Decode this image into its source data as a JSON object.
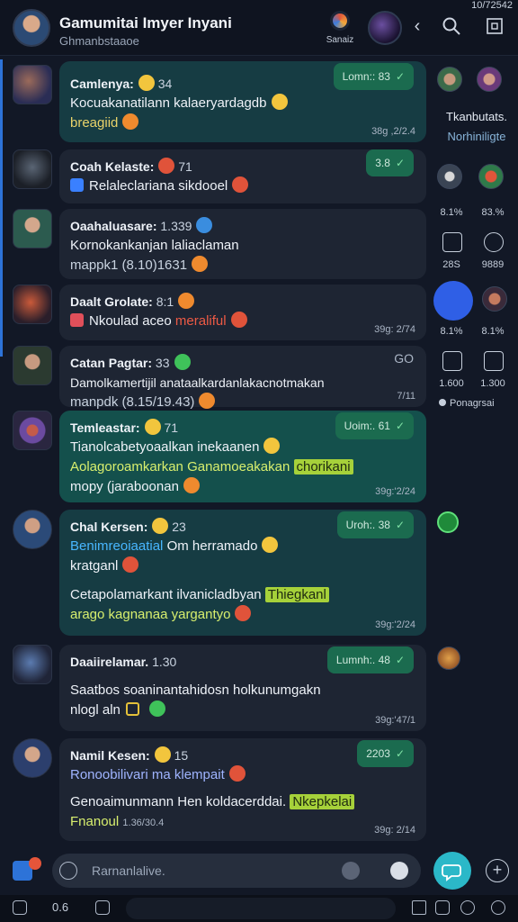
{
  "status_bar": {
    "time": "10/72542"
  },
  "header": {
    "title": "Gamumitai Imyer Inyani",
    "subtitle": "Ghmanbstaaoe",
    "app_label": "Sanaiz",
    "back_icon": "chevron-left-icon",
    "search_icon": "search-icon",
    "menu_icon": "menu-icon"
  },
  "messages": [
    {
      "name": "Camlenya:",
      "count": "34",
      "lines": [
        "Kocuakanatilann kalaeryardagdb",
        "breagiid"
      ],
      "badge": "Lomn:: 83",
      "time": "38g ,2/2.4"
    },
    {
      "name": "Coah Kelaste:",
      "count": "71",
      "lines": [
        "Relaleclariana sikdooel"
      ],
      "badge": "3.8",
      "time": ""
    },
    {
      "name": "Oaahaluasare:",
      "count": "1.339",
      "lines": [
        "Kornokankanjan laliaclaman",
        "mappk1 (8.10)1631"
      ],
      "badge": "",
      "time": ""
    },
    {
      "name": "Daalt Grolate:",
      "count": "8:1",
      "lines": [
        "Nkoulad aceo",
        "meraliful"
      ],
      "badge": "",
      "time": "39g: 2/74"
    },
    {
      "name": "Catan Pagtar:",
      "count": "33",
      "lines": [
        "Damolkamertijil anataalkardanlakacnotmakan",
        "manpdk (8.15/19.43)"
      ],
      "badge": "GO",
      "time": "7/11"
    },
    {
      "name": "Temleastar:",
      "count": "71",
      "lines": [
        "Tianolcabetyoaalkan inekaanen",
        "Aolagoroamkarkan Ganamoeakakan",
        "chorikani",
        "mopy (jaraboonan"
      ],
      "badge": "Uoim:. 61",
      "time": "39g:'2/24"
    },
    {
      "name": "Chal Kersen:",
      "count": "23",
      "lines": [
        "Benimreoiaatial",
        "Om herramado",
        "kratganl",
        "Cetapolamarkant ilvanicladbyan",
        "Thiegkanl",
        "arago kagnanaa yargantyo"
      ],
      "badge": "Uroh:. 38",
      "time": "39g:'2/24"
    },
    {
      "name": "Daaiirelamar.",
      "count": "1.30",
      "lines": [
        "Saatbos soaninantahidosn holkunumgakn",
        "nlogl aln"
      ],
      "badge": "Lumnh:. 48",
      "time": "39g:'47/1"
    },
    {
      "name": "Namil Kesen:",
      "count": "15",
      "lines": [
        "Ronoobilivari ma klempait",
        "Genoaimunmann Hen koldacerddai.",
        "Nkepkelai",
        "Fnanoul"
      ],
      "badge": "2203",
      "time": "39g: 2/14",
      "extra": "1.36/30.4"
    }
  ],
  "rail": {
    "title": "Tkanbutats.",
    "subtitle": "Norhiniligte",
    "stats": [
      "8.1%",
      "83.%",
      "28S",
      "9889",
      "8.1%",
      "8.1%",
      "1.600",
      "1.300"
    ],
    "note": "Ponagrsai"
  },
  "composer": {
    "placeholder": "Rarnanlalive.",
    "send_icon": "send-icon",
    "plus_icon": "plus-icon"
  },
  "bottom_bar": {
    "item1": "0.6"
  },
  "colors": {
    "accent": "#2d73d8",
    "bubble_green": "#14504c",
    "highlight": "#a6d13a",
    "link": "#48b6ff"
  }
}
